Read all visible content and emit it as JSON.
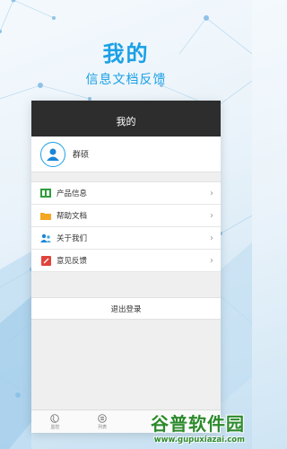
{
  "promo": {
    "title": "我的",
    "subtitle": "信息文档反馈"
  },
  "header": {
    "title": "我的"
  },
  "profile": {
    "name": "群硕",
    "avatar_icon": "user-icon"
  },
  "menu": [
    {
      "label": "产品信息",
      "icon": "product-card-icon",
      "color": "#2e9d3a"
    },
    {
      "label": "帮助文档",
      "icon": "folder-icon",
      "color": "#f5a623"
    },
    {
      "label": "关于我们",
      "icon": "people-icon",
      "color": "#1a86d6"
    },
    {
      "label": "意见反馈",
      "icon": "pencil-note-icon",
      "color": "#e0443a"
    }
  ],
  "logout": {
    "label": "退出登录"
  },
  "tabs": [
    {
      "label": "监控",
      "icon": "globe-icon"
    },
    {
      "label": "列表",
      "icon": "list-icon"
    }
  ],
  "watermark": {
    "main": "谷普软件园",
    "url": "www.gupuxiazai.com"
  },
  "colors": {
    "accent": "#1aa0e6",
    "header_bg": "#2d2d2d"
  }
}
